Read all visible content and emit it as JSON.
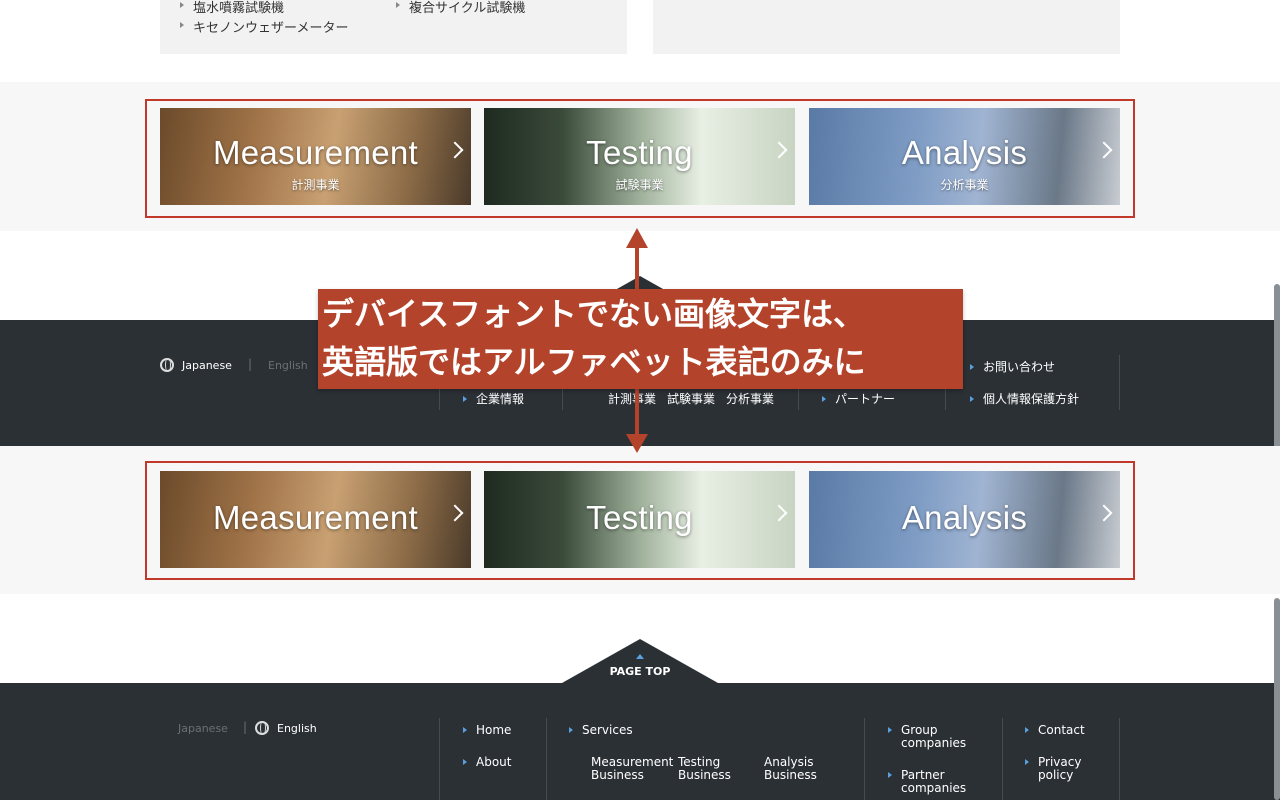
{
  "top_lists": {
    "left_col1": [
      "塩水噴霧試験機",
      "キセノンウェザーメーター"
    ],
    "left_col2": [
      "複合サイクル試験機"
    ]
  },
  "banner_ja": [
    {
      "en": "Measurement",
      "ja": "計測事業"
    },
    {
      "en": "Testing",
      "ja": "試験事業"
    },
    {
      "en": "Analysis",
      "ja": "分析事業"
    }
  ],
  "banner_en": [
    {
      "en": "Measurement"
    },
    {
      "en": "Testing"
    },
    {
      "en": "Analysis"
    }
  ],
  "callout": {
    "line1": "デバイスフォントでない画像文字は、",
    "line2": "英語版ではアルファベット表記のみに"
  },
  "footer_ja": {
    "lang_japanese": "Japanese",
    "lang_english": "English",
    "company": "企業情報",
    "services": [
      "計測事業",
      "試験事業",
      "分析事業"
    ],
    "partner": "パートナー",
    "contact": "お問い合わせ",
    "privacy": "個人情報保護方針"
  },
  "page_top": "PAGE TOP",
  "footer_en": {
    "lang_japanese": "Japanese",
    "lang_english": "English",
    "home": "Home",
    "about": "About",
    "services": "Services",
    "measurement": "Measurement Business",
    "testing": "Testing Business",
    "analysis": "Analysis Business",
    "group_companies": "Group companies",
    "partner_companies": "Partner companies",
    "contact": "Contact",
    "privacy": "Privacy policy"
  },
  "colors": {
    "accent_red": "#b4432b",
    "footer_dark": "#2b3035",
    "link_blue": "#5aa0e0"
  }
}
